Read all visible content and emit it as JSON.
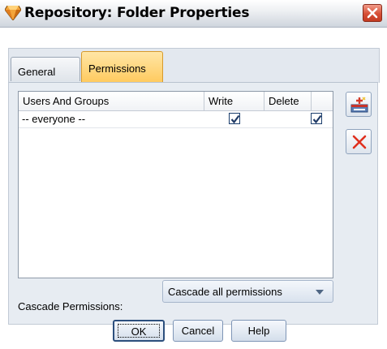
{
  "window": {
    "title": "Repository: Folder Properties",
    "icon": "diamond-icon",
    "close_icon": "close-icon"
  },
  "tabs": [
    {
      "label": "General",
      "selected": false
    },
    {
      "label": "Permissions",
      "selected": true
    }
  ],
  "permissions_table": {
    "columns": [
      "Users And Groups",
      "Write",
      "Delete"
    ],
    "rows": [
      {
        "user": "-- everyone --",
        "write": true,
        "delete": true
      }
    ]
  },
  "side_buttons": {
    "add_icon": "add-user-icon",
    "remove_icon": "delete-x-icon"
  },
  "cascade": {
    "label": "Cascade Permissions:",
    "value": "Cascade all permissions"
  },
  "buttons": {
    "ok": "OK",
    "cancel": "Cancel",
    "help": "Help"
  },
  "colors": {
    "active_tab": "#ffc95c",
    "panel_bg": "#e7ecf2",
    "close_button": "#d64e35",
    "remove_icon": "#e0301e"
  }
}
